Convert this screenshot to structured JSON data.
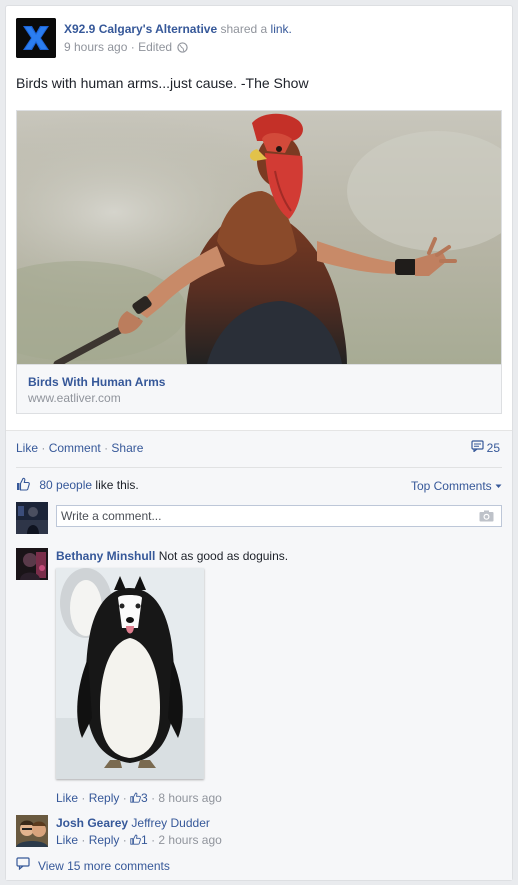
{
  "post": {
    "author": "X92.9 Calgary's Alternative",
    "shared_text": "shared a",
    "shared_link": "link.",
    "time": "9 hours ago",
    "edited": "Edited",
    "message": "Birds with human arms...just cause. -The Show"
  },
  "link_preview": {
    "title": "Birds With Human Arms",
    "domain": "www.eatliver.com"
  },
  "actions": {
    "like": "Like",
    "comment": "Comment",
    "share": "Share",
    "comment_count": "25"
  },
  "likes": {
    "count_text": "80 people",
    "suffix": "like this.",
    "sort_label": "Top Comments"
  },
  "composer": {
    "placeholder": "Write a comment..."
  },
  "comments": [
    {
      "name": "Bethany Minshull",
      "text": "Not as good as doguins.",
      "like": "Like",
      "reply": "Reply",
      "likes": "3",
      "time": "8 hours ago"
    },
    {
      "name": "Josh Gearey",
      "text": "Jeffrey Dudder",
      "like": "Like",
      "reply": "Reply",
      "likes": "1",
      "time": "2 hours ago"
    }
  ],
  "view_more": "View 15 more comments",
  "colors": {
    "link_blue": "#365899",
    "meta_grey": "#90949c",
    "background": "#e9ebee"
  }
}
